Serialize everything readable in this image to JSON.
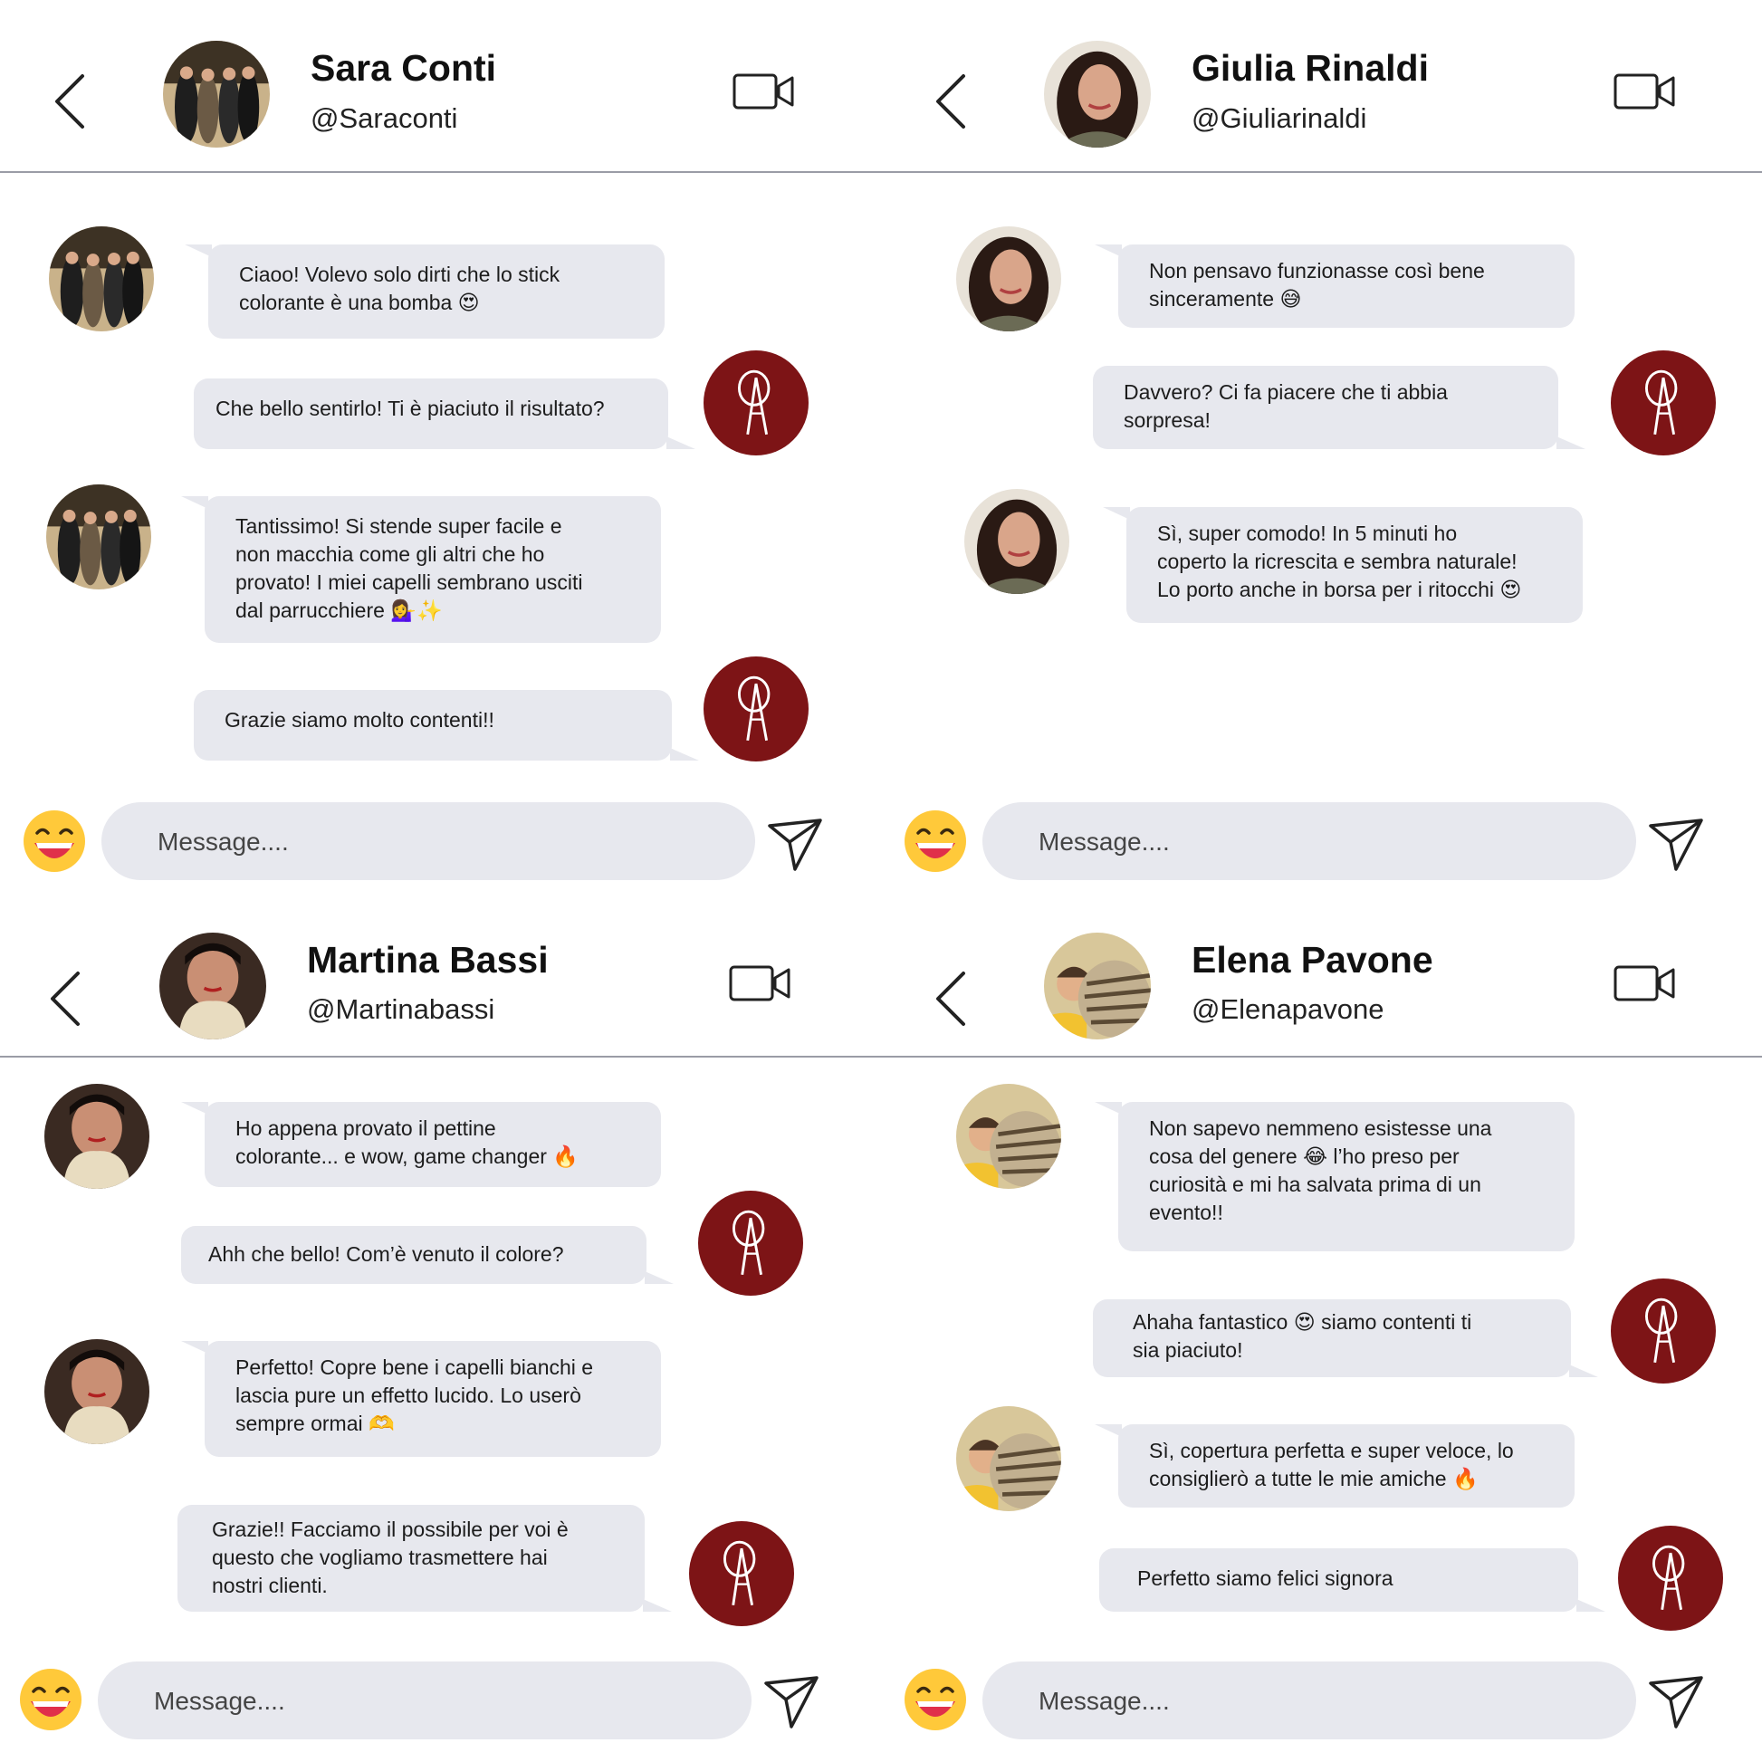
{
  "colors": {
    "bubble": "#e7e8ee",
    "brand": "#7d1416",
    "divider": "#9a9ca6"
  },
  "icons": {
    "back": "chevron-left-icon",
    "video": "video-camera-icon",
    "emoji": "grinning-face-icon",
    "send": "send-icon"
  },
  "brand_logo_text": "OA",
  "conversations": [
    {
      "name": "Sara Conti",
      "handle": "@Saraconti",
      "input_placeholder": "Message....",
      "messages": [
        {
          "from": "user",
          "lines": [
            "Ciaoo! Volevo solo dirti che lo stick",
            "colorante è una bomba 😍"
          ]
        },
        {
          "from": "brand",
          "lines": [
            "Che bello sentirlo! Ti è piaciuto il risultato?"
          ]
        },
        {
          "from": "user",
          "lines": [
            "Tantissimo! Si stende super facile e",
            "non macchia come gli altri che ho",
            "provato! I miei capelli sembrano usciti",
            "dal parrucchiere 💁‍♀️✨"
          ]
        },
        {
          "from": "brand",
          "lines": [
            "Grazie siamo molto contenti!!"
          ]
        }
      ]
    },
    {
      "name": "Giulia Rinaldi",
      "handle": "@Giuliarinaldi",
      "input_placeholder": "Message....",
      "messages": [
        {
          "from": "user",
          "lines": [
            "Non pensavo funzionasse così bene",
            "sinceramente 😅"
          ]
        },
        {
          "from": "brand",
          "lines": [
            "Davvero? Ci fa piacere che ti abbia",
            "sorpresa!"
          ]
        },
        {
          "from": "user",
          "lines": [
            "Sì, super comodo! In 5 minuti ho",
            "coperto la ricrescita e sembra naturale!",
            "Lo porto anche in borsa per i ritocchi 😍"
          ]
        }
      ]
    },
    {
      "name": "Martina Bassi",
      "handle": "@Martinabassi",
      "input_placeholder": "Message....",
      "messages": [
        {
          "from": "user",
          "lines": [
            "Ho appena provato il pettine",
            "colorante... e wow, game changer 🔥"
          ]
        },
        {
          "from": "brand",
          "lines": [
            "Ahh che bello! Com’è venuto il colore?"
          ]
        },
        {
          "from": "user",
          "lines": [
            "Perfetto! Copre bene i capelli bianchi e",
            "lascia pure un effetto lucido. Lo userò",
            "sempre ormai 🫶"
          ]
        },
        {
          "from": "brand",
          "lines": [
            "Grazie!! Facciamo il possibile per voi è",
            "questo che vogliamo trasmettere hai",
            "nostri clienti."
          ]
        }
      ]
    },
    {
      "name": "Elena Pavone",
      "handle": "@Elenapavone",
      "input_placeholder": "Message....",
      "messages": [
        {
          "from": "user",
          "lines": [
            "Non sapevo nemmeno esistesse una",
            "cosa del genere 😂 l’ho preso per",
            "curiosità e mi ha salvata prima di un",
            "evento!!"
          ]
        },
        {
          "from": "brand",
          "lines": [
            "Ahaha fantastico 😍 siamo contenti ti",
            "sia piaciuto!"
          ]
        },
        {
          "from": "user",
          "lines": [
            "Sì, copertura perfetta e super veloce, lo",
            "consiglierò a tutte le mie amiche 🔥"
          ]
        },
        {
          "from": "brand",
          "lines": [
            "Perfetto siamo felici signora"
          ]
        }
      ]
    }
  ]
}
